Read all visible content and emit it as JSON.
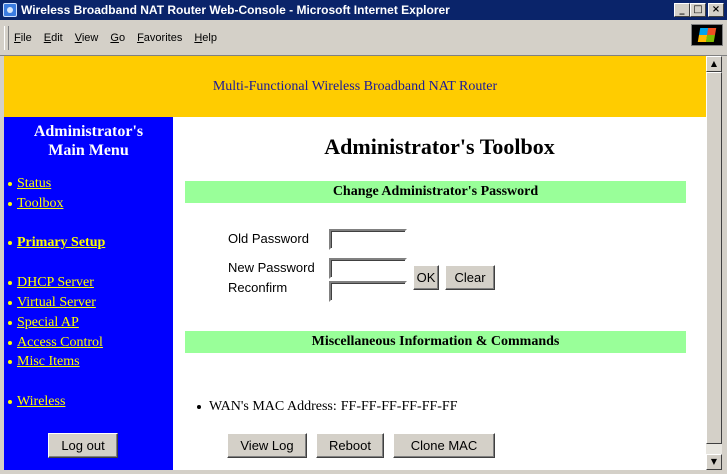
{
  "window": {
    "title": "Wireless Broadband NAT Router Web-Console - Microsoft Internet Explorer",
    "minimize": "_",
    "maximize": "□",
    "close": "×"
  },
  "menubar": {
    "items": [
      "File",
      "Edit",
      "View",
      "Go",
      "Favorites",
      "Help"
    ]
  },
  "header": {
    "title": "Multi-Functional Wireless Broadband NAT Router"
  },
  "sidebar": {
    "title_line1": "Administrator's",
    "title_line2": "Main Menu",
    "items": [
      {
        "label": "Status"
      },
      {
        "label": "Toolbox"
      },
      {
        "label": "Primary Setup"
      },
      {
        "label": "DHCP Server"
      },
      {
        "label": "Virtual Server"
      },
      {
        "label": "Special AP"
      },
      {
        "label": "Access Control"
      },
      {
        "label": "Misc Items"
      },
      {
        "label": "Wireless"
      }
    ],
    "logout_label": "Log out"
  },
  "main": {
    "title": "Administrator's Toolbox",
    "password_section": {
      "heading": "Change Administrator's Password",
      "old_label": "Old Password",
      "new_label": "New Password",
      "reconfirm_label": "Reconfirm",
      "old_value": "",
      "new_value": "",
      "reconfirm_value": "",
      "ok_label": "OK",
      "clear_label": "Clear"
    },
    "misc_section": {
      "heading": "Miscellaneous Information & Commands",
      "mac_label": "WAN's MAC Address:",
      "mac_value": "FF-FF-FF-FF-FF-FF",
      "view_log_label": "View Log",
      "reboot_label": "Reboot",
      "clone_mac_label": "Clone MAC"
    }
  },
  "colors": {
    "titlebar": "#0a246a",
    "header_bg": "#ffcc00",
    "sidebar_bg": "#0000ff",
    "sidebar_link": "#ffff00",
    "section_bar": "#99ff99"
  }
}
